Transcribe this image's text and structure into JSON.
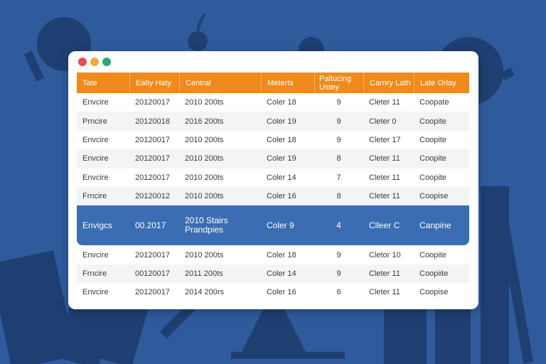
{
  "window": {
    "controls": [
      {
        "name": "close",
        "color": "#e94b57"
      },
      {
        "name": "minimize",
        "color": "#f2a93b"
      },
      {
        "name": "maximize",
        "color": "#2aa876"
      }
    ]
  },
  "colors": {
    "background": "#2f5b9c",
    "header": "#f08a1c",
    "selected_row": "#3a6db1"
  },
  "table": {
    "columns": [
      "Tate",
      "Ealty Haty",
      "Central",
      "Meterts",
      "Paltucing Ustey",
      "Carnry Lath",
      "Late Orlay"
    ],
    "rows": [
      [
        "Envcire",
        "20120017",
        "2010 200ts",
        "Coler 18",
        "9",
        "Cleter 11",
        "Coopate"
      ],
      [
        "Prncire",
        "20120018",
        "2016 200ts",
        "Coler 19",
        "9",
        "Cleter 0",
        "Coopite"
      ],
      [
        "Envcire",
        "20120017",
        "2010 200ts",
        "Coler 18",
        "9",
        "Cleter 17",
        "Coopite"
      ],
      [
        "Envcire",
        "20120017",
        "2010 200ts",
        "Coler 19",
        "8",
        "Cleter 11",
        "Coopite"
      ],
      [
        "Envcire",
        "20120017",
        "2010 200ts",
        "Coler 14",
        "7",
        "Cleter 11",
        "Coopite"
      ],
      [
        "Frncire",
        "20120012",
        "2010 200ts",
        "Coler 16",
        "8",
        "Cleter 11",
        "Coopise"
      ]
    ],
    "selected_row": [
      "Envigcs",
      "00.2017",
      "2010 Stairs Prandpies",
      "Coler 9",
      "4",
      "Clleer C",
      "Canpine"
    ],
    "rows_after": [
      [
        "Envcire",
        "20120017",
        "2010 200ts",
        "Coler 18",
        "9",
        "Cletor 10",
        "Coopite"
      ],
      [
        "Frncire",
        "00120017",
        "2011 200ts",
        "Coler 14",
        "9",
        "Cleter 11",
        "Coopiite"
      ],
      [
        "Envcire",
        "20120017",
        "2014 200rs",
        "Coler 16",
        "6",
        "Cleter 11",
        "Coopise"
      ]
    ]
  }
}
